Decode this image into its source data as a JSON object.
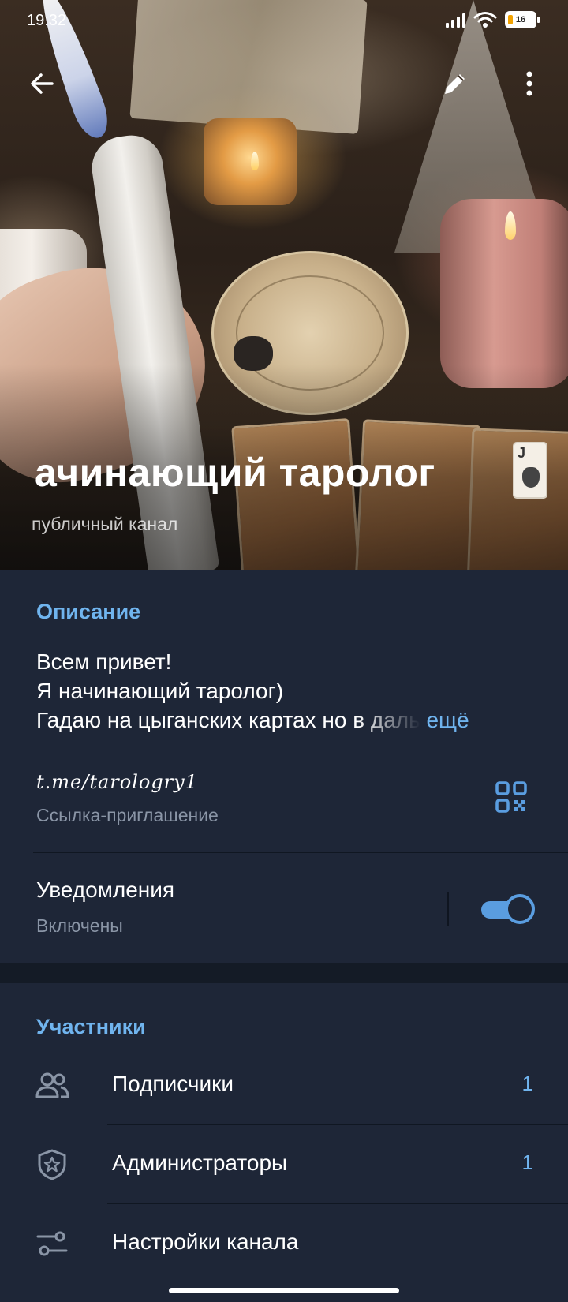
{
  "status_bar": {
    "time": "19:32",
    "battery": "16"
  },
  "header": {
    "back_icon": "arrow-left-icon",
    "edit_icon": "pencil-icon",
    "menu_icon": "more-vertical-icon",
    "channel_title": "ачинающий таролог",
    "channel_type": "публичный канал",
    "title_emoji": "joker-card-icon",
    "joker_letter": "J"
  },
  "info": {
    "description_title": "Описание",
    "description_lines": [
      "Всем привет!",
      "Я начинающий таролог)",
      "Гадаю на цыганских картах но в даль"
    ],
    "more_label": "ещё",
    "invite_link": "t.me/tarologry1",
    "invite_label": "Ссылка-приглашение",
    "notifications_title": "Уведомления",
    "notifications_status": "Включены",
    "notifications_enabled": true
  },
  "members": {
    "title": "Участники",
    "items": [
      {
        "label": "Подписчики",
        "count": "1",
        "icon": "users-icon"
      },
      {
        "label": "Администраторы",
        "count": "1",
        "icon": "shield-star-icon"
      },
      {
        "label": "Настройки канала",
        "count": "",
        "icon": "settings-sliders-icon"
      }
    ]
  },
  "colors": {
    "accent": "#70b4ee",
    "background": "#1e2637",
    "secondary_text": "#8a95a6"
  }
}
